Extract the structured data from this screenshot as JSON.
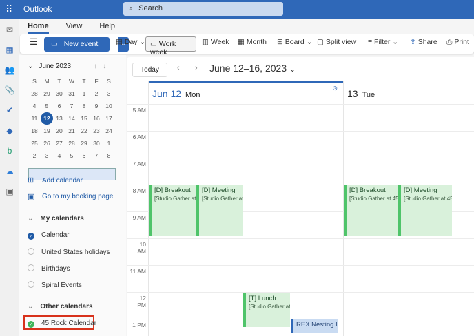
{
  "app": {
    "title": "Outlook",
    "search_placeholder": "Search"
  },
  "tabs": [
    "Home",
    "View",
    "Help"
  ],
  "ribbon": {
    "new_event": "New event",
    "day": "Day",
    "work_week": "Work week",
    "week": "Week",
    "month": "Month",
    "board": "Board",
    "split_view": "Split view",
    "filter": "Filter",
    "share": "Share",
    "print": "Print"
  },
  "mini_calendar": {
    "month": "June 2023",
    "weekdays": [
      "S",
      "M",
      "T",
      "W",
      "T",
      "F",
      "S"
    ],
    "weeks": [
      [
        "28",
        "29",
        "30",
        "31",
        "1",
        "2",
        "3"
      ],
      [
        "4",
        "5",
        "6",
        "7",
        "8",
        "9",
        "10"
      ],
      [
        "11",
        "12",
        "13",
        "14",
        "15",
        "16",
        "17"
      ],
      [
        "18",
        "19",
        "20",
        "21",
        "22",
        "23",
        "24"
      ],
      [
        "25",
        "26",
        "27",
        "28",
        "29",
        "30",
        "1"
      ],
      [
        "2",
        "3",
        "4",
        "5",
        "6",
        "7",
        "8"
      ]
    ],
    "today": "12"
  },
  "links": {
    "add_calendar": "Add calendar",
    "booking": "Go to my booking page"
  },
  "my_calendars": {
    "title": "My calendars",
    "items": [
      "Calendar",
      "United States holidays",
      "Birthdays",
      "Spiral Events"
    ]
  },
  "other_calendars": {
    "title": "Other calendars",
    "items": [
      "45 Rock Calendar"
    ]
  },
  "main": {
    "today": "Today",
    "range": "June 12–16, 2023",
    "days": [
      {
        "num": "Jun 12",
        "name": "Mon"
      },
      {
        "num": "13",
        "name": "Tue"
      }
    ],
    "hours": [
      "5 AM",
      "6 AM",
      "7 AM",
      "8 AM",
      "9 AM",
      "10 AM",
      "11 AM",
      "12 PM",
      "1 PM"
    ],
    "events": [
      {
        "title": "[D] Breakout",
        "sub": "[Studio Gather at"
      },
      {
        "title": "[D] Meeting",
        "sub": "[Studio Gather at"
      },
      {
        "title": "[T] Lunch",
        "sub": "[Studio Gather at"
      },
      {
        "title": "REX Nesting Is",
        "sub": ""
      },
      {
        "title": "[D] Breakout",
        "sub": "[Studio Gather at 45"
      },
      {
        "title": "[D] Meeting",
        "sub": "[Studio Gather at 45"
      }
    ]
  },
  "colors": {
    "brand": "#2f68b8",
    "event_green": "#d9f1db",
    "event_border": "#4fc46a"
  }
}
